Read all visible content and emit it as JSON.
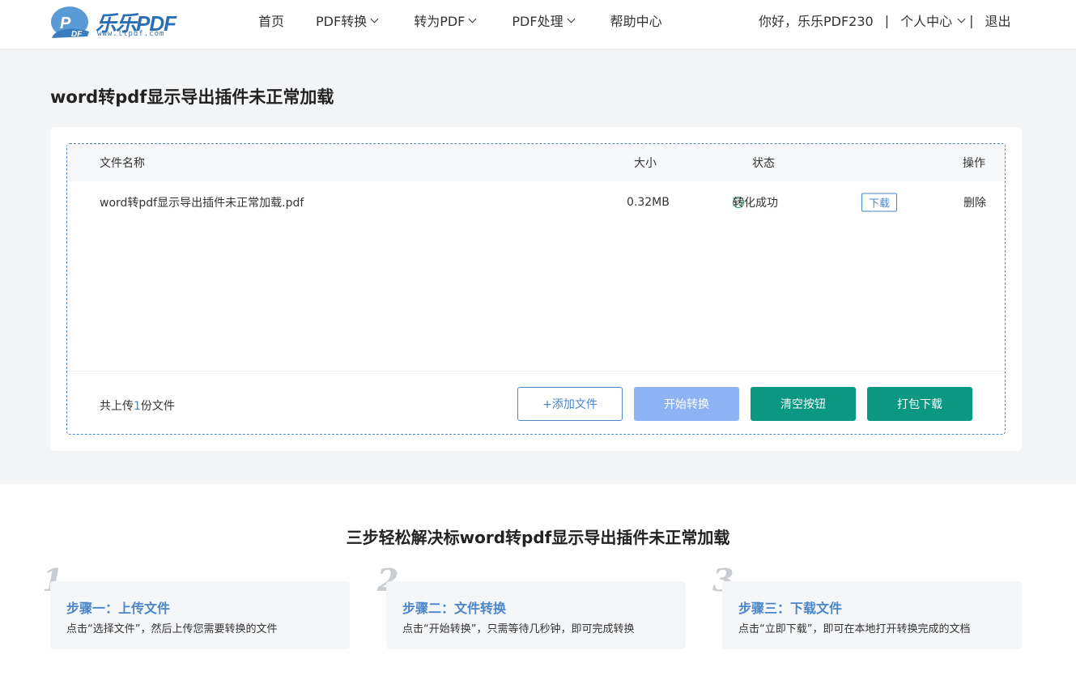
{
  "header": {
    "logo_text": "乐乐PDF",
    "logo_url": "www.llpdf.com",
    "nav": [
      {
        "label": "首页",
        "dropdown": false
      },
      {
        "label": "PDF转换",
        "dropdown": true
      },
      {
        "label": "转为PDF",
        "dropdown": true
      },
      {
        "label": "PDF处理",
        "dropdown": true
      },
      {
        "label": "帮助中心",
        "dropdown": false
      }
    ],
    "greeting": "你好，乐乐PDF230",
    "separator": "|",
    "user_center": "个人中心",
    "logout": "退出"
  },
  "page_title": "word转pdf显示导出插件未正常加载",
  "table": {
    "headers": {
      "name": "文件名称",
      "size": "大小",
      "status": "状态",
      "action": "操作"
    },
    "rows": [
      {
        "name": "word转pdf显示导出插件未正常加载.pdf",
        "size": "0.32MB",
        "status": "转化成功",
        "download": "下载",
        "delete": "删除"
      }
    ]
  },
  "footer_bar": {
    "count_prefix": "共上传",
    "count": "1",
    "count_suffix": "份文件",
    "add_file": "+添加文件",
    "start": "开始转换",
    "clear": "清空按钮",
    "pack_download": "打包下载"
  },
  "steps_title": "三步轻松解决标word转pdf显示导出插件未正常加载",
  "steps": [
    {
      "num": "1",
      "title": "步骤一：上传文件",
      "desc": "点击“选择文件”，然后上传您需要转换的文件"
    },
    {
      "num": "2",
      "title": "步骤二：文件转换",
      "desc": "点击“开始转换”，只需等待几秒钟，即可完成转换"
    },
    {
      "num": "3",
      "title": "步骤三：下载文件",
      "desc": "点击“立即下载”，即可在本地打开转换完成的文档"
    }
  ],
  "colors": {
    "accent": "#4a86c8",
    "teal": "#0a9882",
    "start_btn": "#8db3f5",
    "success": "#20a162"
  }
}
